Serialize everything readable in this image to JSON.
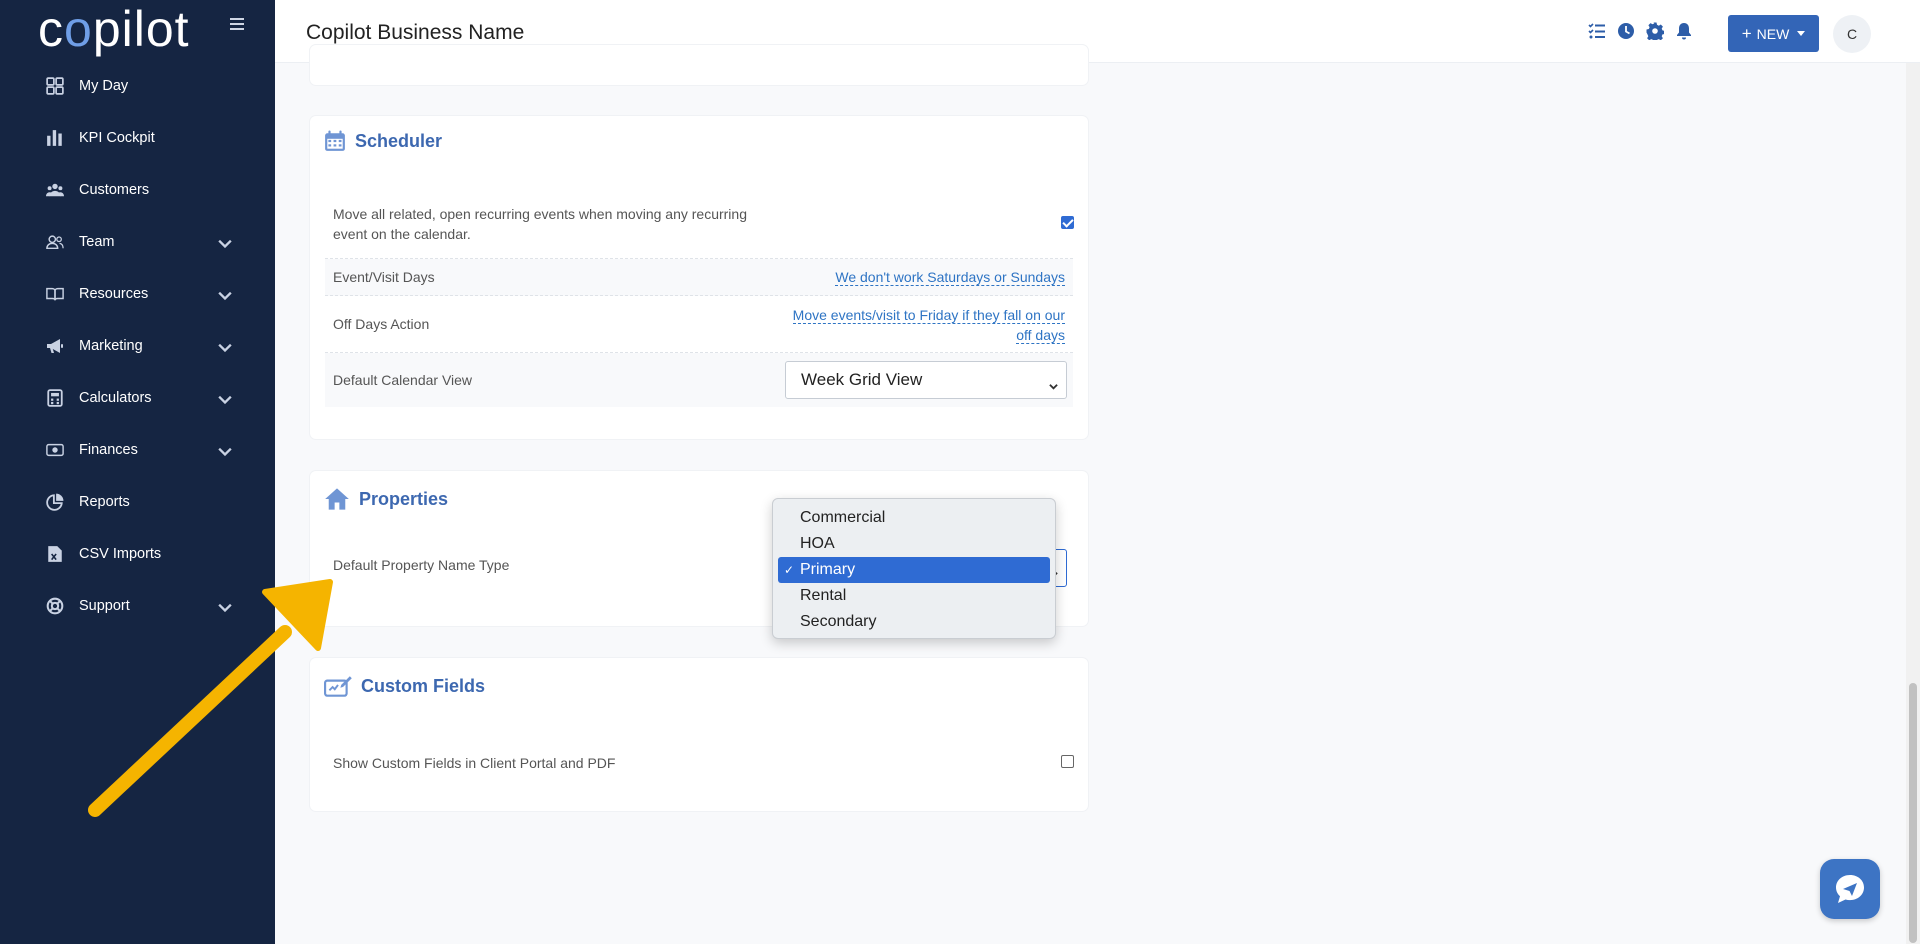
{
  "app": {
    "logo_text_pre": "c",
    "logo_text_o": "o",
    "logo_text_post": "pilot"
  },
  "sidebar": {
    "items": [
      {
        "label": "My Day",
        "icon": "grid-icon",
        "expandable": false
      },
      {
        "label": "KPI Cockpit",
        "icon": "bar-chart-icon",
        "expandable": false
      },
      {
        "label": "Customers",
        "icon": "users-icon",
        "expandable": false
      },
      {
        "label": "Team",
        "icon": "team-icon",
        "expandable": true
      },
      {
        "label": "Resources",
        "icon": "book-icon",
        "expandable": true
      },
      {
        "label": "Marketing",
        "icon": "megaphone-icon",
        "expandable": true
      },
      {
        "label": "Calculators",
        "icon": "calculator-icon",
        "expandable": true
      },
      {
        "label": "Finances",
        "icon": "money-icon",
        "expandable": true
      },
      {
        "label": "Reports",
        "icon": "pie-chart-icon",
        "expandable": false
      },
      {
        "label": "CSV Imports",
        "icon": "csv-file-icon",
        "expandable": false
      },
      {
        "label": "Support",
        "icon": "lifebuoy-icon",
        "expandable": true
      }
    ]
  },
  "header": {
    "business_name": "Copilot Business Name",
    "icons": [
      "tasks-icon",
      "clock-icon",
      "gear-icon",
      "bell-icon"
    ],
    "new_button": "NEW",
    "avatar_initial": "C"
  },
  "scheduler": {
    "title": "Scheduler",
    "move_recurring_label": "Move all related, open recurring events when moving any recurring event on the calendar.",
    "move_recurring_checked": true,
    "visit_days_label": "Event/Visit Days",
    "visit_days_value": "We don't work Saturdays or Sundays",
    "off_days_label": "Off Days Action",
    "off_days_value": "Move events/visit to Friday if they fall on our off days",
    "calendar_view_label": "Default Calendar View",
    "calendar_view_value": "Week Grid View"
  },
  "properties": {
    "title": "Properties",
    "name_type_label": "Default Property Name Type",
    "options": [
      "Commercial",
      "HOA",
      "Primary",
      "Rental",
      "Secondary"
    ],
    "selected": "Primary"
  },
  "custom_fields": {
    "title": "Custom Fields",
    "show_label": "Show Custom Fields in Client Portal and PDF",
    "show_checked": false
  },
  "colors": {
    "sidebar_bg": "#152542",
    "accent": "#3365b7",
    "arrow": "#f5b400"
  }
}
